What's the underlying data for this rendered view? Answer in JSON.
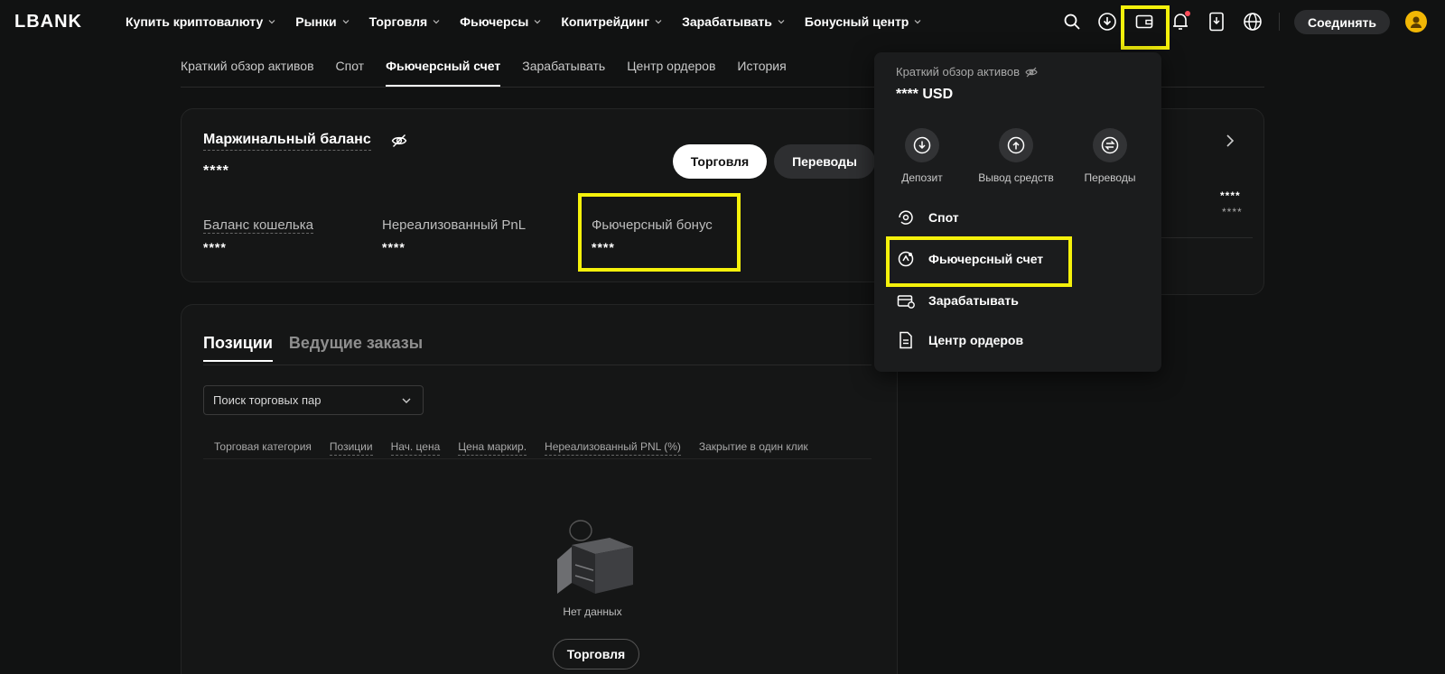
{
  "brand": {
    "logo": "LBANK"
  },
  "nav": {
    "items": [
      {
        "label": "Купить криптовалюту"
      },
      {
        "label": "Рынки"
      },
      {
        "label": "Торговля"
      },
      {
        "label": "Фьючерсы"
      },
      {
        "label": "Копитрейдинг"
      },
      {
        "label": "Зарабатывать"
      },
      {
        "label": "Бонусный центр"
      }
    ],
    "connect_label": "Соединять"
  },
  "subtabs": [
    {
      "label": "Краткий обзор активов"
    },
    {
      "label": "Спот"
    },
    {
      "label": "Фьючерсный счет",
      "active": true
    },
    {
      "label": "Зарабатывать"
    },
    {
      "label": "Центр ордеров"
    },
    {
      "label": "История"
    }
  ],
  "margin": {
    "title": "Маржинальный баланс",
    "value": "****",
    "trade_button": "Торговля",
    "transfer_button": "Переводы",
    "wallet_label": "Баланс кошелька",
    "wallet_value": "****",
    "pnl_label": "Нереализованный PnL",
    "pnl_value": "****",
    "bonus_label": "Фьючерсный бонус",
    "bonus_value": "****"
  },
  "positions": {
    "tabs": [
      {
        "label": "Позиции",
        "active": true
      },
      {
        "label": "Ведущие заказы"
      }
    ],
    "search_placeholder": "Поиск торговых пар",
    "columns": [
      "Торговая категория",
      "Позиции",
      "Нач. цена",
      "Цена маркир.",
      "Нереализованный PNL (%)",
      "Закрытие в один клик"
    ],
    "empty_text": "Нет данных",
    "trade_button": "Торговля"
  },
  "right_card": {
    "value1": "****",
    "value2": "****"
  },
  "dropdown": {
    "title": "Краткий обзор активов",
    "total": "**** USD",
    "actions": [
      {
        "label": "Депозит"
      },
      {
        "label": "Вывод средств"
      },
      {
        "label": "Переводы"
      }
    ],
    "items": [
      {
        "label": "Спот"
      },
      {
        "label": "Фьючерсный счет"
      },
      {
        "label": "Зарабатывать"
      },
      {
        "label": "Центр ордеров"
      }
    ]
  },
  "colors": {
    "highlight": "#f5f10b",
    "accent_avatar": "#f2b705",
    "notification": "#ff4d5a"
  }
}
